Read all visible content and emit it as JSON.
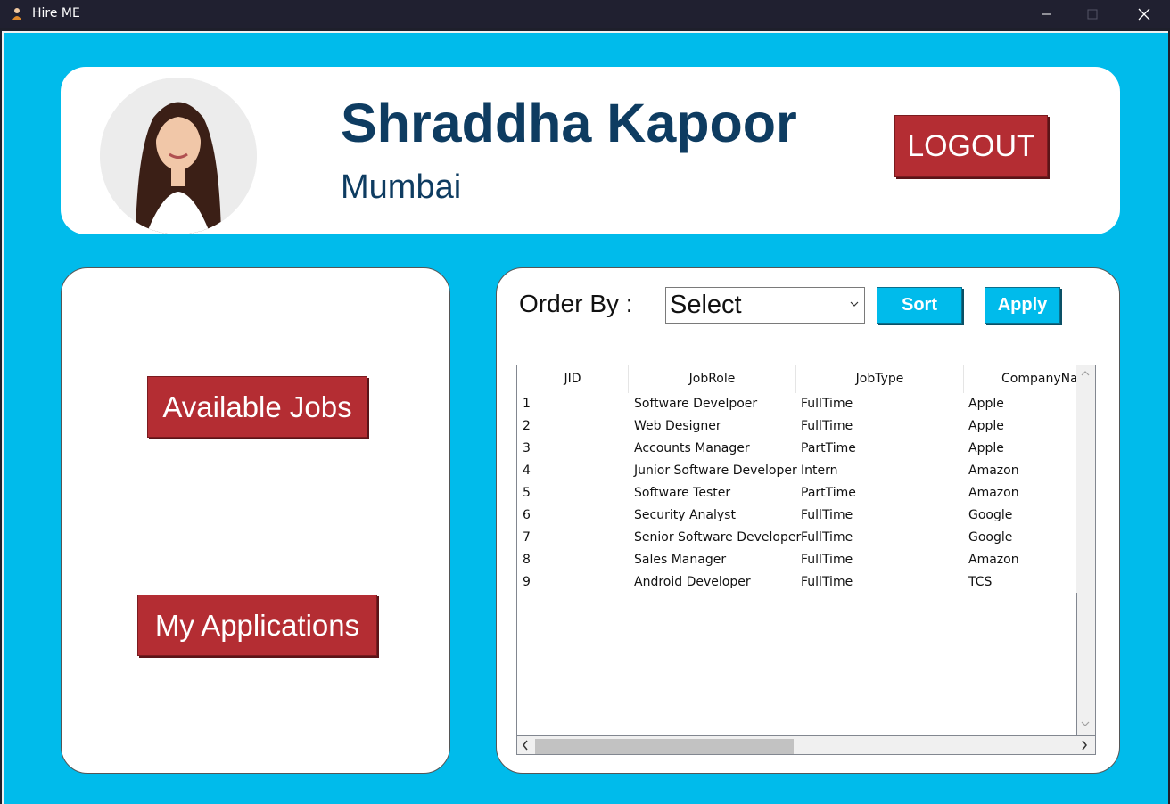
{
  "window": {
    "title": "Hire ME",
    "icon": "user-person-icon",
    "controls": [
      "minimize-icon",
      "maximize-icon",
      "close-icon"
    ]
  },
  "profile": {
    "name": "Shraddha Kapoor",
    "city": "Mumbai",
    "logout_label": "LOGOUT"
  },
  "nav": {
    "available_jobs_label": "Available Jobs",
    "my_applications_label": "My Applications"
  },
  "jobs": {
    "order_by_label": "Order By :",
    "order_by_selected": "Select",
    "sort_label": "Sort",
    "apply_label": "Apply",
    "columns": [
      "JID",
      "JobRole",
      "JobType",
      "CompanyName"
    ],
    "rows": [
      [
        "1",
        "Software Develpoer",
        "FullTime",
        "Apple"
      ],
      [
        "2",
        "Web Designer",
        "FullTime",
        "Apple"
      ],
      [
        "3",
        "Accounts Manager",
        "PartTime",
        "Apple"
      ],
      [
        "4",
        "Junior Software Developer",
        "Intern",
        "Amazon"
      ],
      [
        "5",
        "Software Tester",
        "PartTime",
        "Amazon"
      ],
      [
        "6",
        "Security Analyst",
        "FullTime",
        "Google"
      ],
      [
        "7",
        "Senior Software Developer",
        "FullTime",
        "Google"
      ],
      [
        "8",
        "Sales Manager",
        "FullTime",
        "Amazon"
      ],
      [
        "9",
        "Android Developer",
        "FullTime",
        "TCS"
      ]
    ]
  },
  "colors": {
    "background": "#00bbeb",
    "title_bar": "#202030",
    "name_text": "#0e3c61",
    "red_button": "#b42d33",
    "blue_button": "#00bbeb"
  }
}
